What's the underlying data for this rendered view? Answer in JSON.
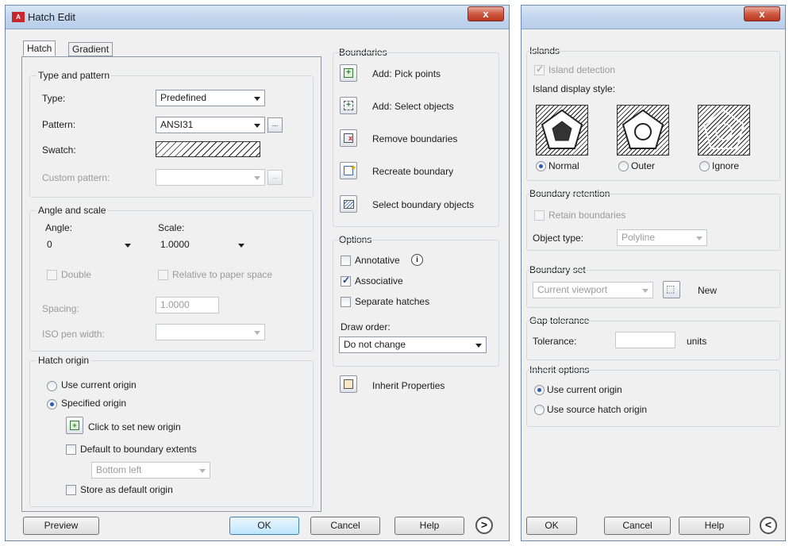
{
  "left_dialog": {
    "title": "Hatch Edit",
    "close_label": "x",
    "tabs": [
      "Hatch",
      "Gradient"
    ],
    "type_pattern": {
      "group_title": "Type and pattern",
      "type_label": "Type:",
      "type_value": "Predefined",
      "pattern_label": "Pattern:",
      "pattern_value": "ANSI31",
      "pattern_browse": "...",
      "swatch_label": "Swatch:",
      "custom_label": "Custom pattern:",
      "custom_value": "",
      "custom_browse": "..."
    },
    "angle_scale": {
      "group_title": "Angle and scale",
      "angle_label": "Angle:",
      "angle_value": "0",
      "scale_label": "Scale:",
      "scale_value": "1.0000",
      "double_label": "Double",
      "relative_label": "Relative to paper space",
      "spacing_label": "Spacing:",
      "spacing_value": "1.0000",
      "iso_label": "ISO pen width:",
      "iso_value": ""
    },
    "hatch_origin": {
      "group_title": "Hatch origin",
      "use_current": "Use current origin",
      "specified": "Specified origin",
      "click_set": "Click to set new origin",
      "default_extents": "Default to boundary extents",
      "extents_value": "Bottom left",
      "store_default": "Store as default origin"
    },
    "boundaries": {
      "group_title": "Boundaries",
      "add_pick": "Add: Pick points",
      "add_select": "Add: Select objects",
      "remove": "Remove boundaries",
      "recreate": "Recreate boundary",
      "select_objects": "Select boundary objects"
    },
    "options": {
      "group_title": "Options",
      "annotative": "Annotative",
      "info_glyph": "i",
      "associative": "Associative",
      "separate": "Separate hatches",
      "draw_order_label": "Draw order:",
      "draw_order_value": "Do not change"
    },
    "inherit": "Inherit Properties",
    "buttons": {
      "preview": "Preview",
      "ok": "OK",
      "cancel": "Cancel",
      "help": "Help",
      "expand": ">"
    }
  },
  "right_dialog": {
    "close_label": "x",
    "islands": {
      "group_title": "Islands",
      "detection": "Island detection",
      "display_style_label": "Island display style:",
      "styles": [
        "Normal",
        "Outer",
        "Ignore"
      ],
      "selected_style": "Normal"
    },
    "retention": {
      "group_title": "Boundary retention",
      "retain": "Retain boundaries",
      "object_type_label": "Object type:",
      "object_type_value": "Polyline"
    },
    "boundary_set": {
      "group_title": "Boundary set",
      "value": "Current viewport",
      "new_label": "New"
    },
    "gap": {
      "group_title": "Gap tolerance",
      "tolerance_label": "Tolerance:",
      "tolerance_value": "",
      "units": "units"
    },
    "inherit_options": {
      "group_title": "Inherit options",
      "use_current": "Use current origin",
      "use_source": "Use source hatch origin"
    },
    "buttons": {
      "ok": "OK",
      "cancel": "Cancel",
      "help": "Help",
      "collapse": "<"
    }
  },
  "colors": {
    "titlebar": "#c3d6ee",
    "close_red": "#cf5a43",
    "dialog_bg": "#f0f0f0",
    "accent_blue": "#2d5bb3"
  }
}
